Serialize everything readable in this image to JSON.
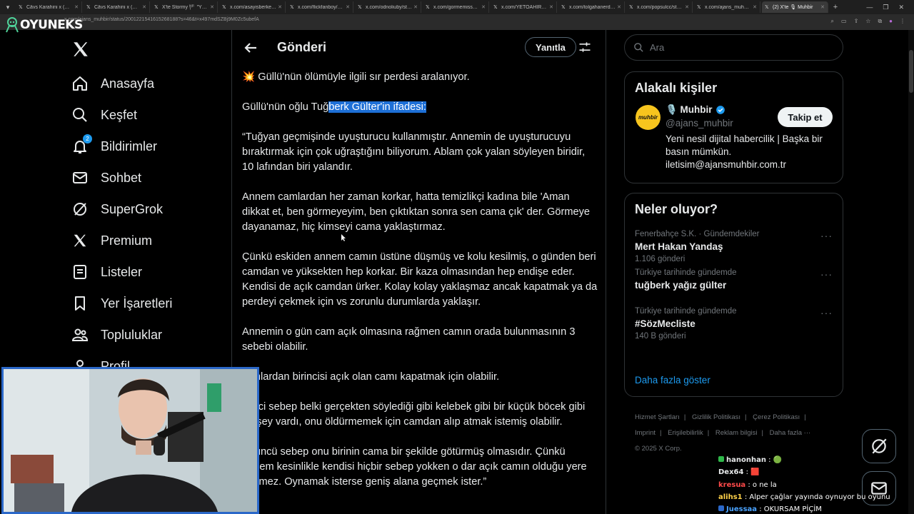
{
  "browser": {
    "tabs": [
      {
        "label": "Câvs Karahini x (@cs"
      },
      {
        "label": "Câvs Karahini x (@cs"
      },
      {
        "label": "X'te Stormy 🏴 \"Yüzsü"
      },
      {
        "label": "x.com/asayisberkemal"
      },
      {
        "label": "x.com/flickfanboy/stat"
      },
      {
        "label": "x.com/odnoliuby/statu"
      },
      {
        "label": "x.com/gormemissay/s"
      },
      {
        "label": "x.com/YETOAHIR/statu"
      },
      {
        "label": "x.com/tolgahanerdog"
      },
      {
        "label": "x.com/popsulcc/statu"
      },
      {
        "label": "x.com/ajans_muhbir/s"
      },
      {
        "label": "(2) X'te 🎙 Muhbir"
      }
    ],
    "url": "x.com/ajans_muhbir/status/2001221541615268188?s=46&t=x497mdSZBj9M0Zc5ubefA"
  },
  "overlay": {
    "logo_text": "OYUNEKS"
  },
  "nav": {
    "items": [
      {
        "label": "Anasayfa",
        "icon": "home-icon"
      },
      {
        "label": "Keşfet",
        "icon": "search-icon"
      },
      {
        "label": "Bildirimler",
        "icon": "bell-icon",
        "badge": "2"
      },
      {
        "label": "Sohbet",
        "icon": "mail-icon"
      },
      {
        "label": "SuperGrok",
        "icon": "grok-icon"
      },
      {
        "label": "Premium",
        "icon": "x-icon"
      },
      {
        "label": "Listeler",
        "icon": "list-icon"
      },
      {
        "label": "Yer İşaretleri",
        "icon": "bookmark-icon"
      },
      {
        "label": "Topluluklar",
        "icon": "community-icon"
      },
      {
        "label": "Profil",
        "icon": "profile-icon"
      }
    ]
  },
  "post": {
    "header_title": "Gönderi",
    "reply_label": "Yanıtla",
    "line1": "💥 Güllü'nün ölümüyle ilgili sır perdesi aralanıyor.",
    "line2_plain": "Güllü'nün oğlu Tuğ",
    "line2_highlight": "berk Gülter'in ifadesi:",
    "paragraphs": [
      "“Tuğyan geçmişinde uyuşturucu kullanmıştır. Annemin de uyuşturucuyu bıraktırmak için çok uğraştığını biliyorum. Ablam çok yalan söyleyen biridir, 10 lafından biri yalandır.",
      "Annem camlardan her zaman korkar, hatta temizlikçi kadına bile 'Aman dikkat et, ben görmeyeyim, ben çıktıktan sonra sen cama çık' der. Görmeye dayanamaz, hiç kimseyi cama yaklaştırmaz.",
      "Çünkü eskiden annem camın üstüne düşmüş ve kolu kesilmiş, o günden beri camdan ve yüksekten hep korkar. Bir kaza olmasından hep endişe eder. Kendisi de açık camdan ürker. Kolay kolay yaklaşmaz ancak kapatmak ya da perdeyi çekmek için vs zorunlu durumlarda yaklaşır.",
      "Annemin o gün cam açık olmasına rağmen camın orada bulunmasının 3 sebebi olabilir.",
      "Bunlardan birincisi açık olan camı kapatmak için olabilir.",
      "İkinci sebep belki gerçekten söylediği gibi kelebek gibi bir küçük böcek gibi bir şey vardı, onu öldürmemek için camdan alıp atmak istemiş olabilir.",
      "Üçüncü sebep onu birinin cama bir şekilde götürmüş olmasıdır. Çünkü annem kesinlikle kendisi hiçbir sebep yokken o dar açık camın olduğu yere geçmez. Oynamak isterse geniş alana geçmek ister.”"
    ]
  },
  "right": {
    "search_placeholder": "Ara",
    "related": {
      "title": "Alakalı kişiler",
      "name": "🎙️ Muhbir",
      "handle": "@ajans_muhbir",
      "bio": "Yeni nesil dijital habercilik | Başka bir basın mümkün. iletisim@ajansmuhbir.com.tr",
      "follow_label": "Takip et",
      "avatar_text": "muhbir"
    },
    "trends": {
      "title": "Neler oluyor?",
      "items": [
        {
          "context": "Fenerbahçe S.K. · Gündemdekiler",
          "name": "Mert Hakan Yandaş",
          "count": "1.106 gönderi"
        },
        {
          "context": "Türkiye tarihinde gündemde",
          "name": "tuğberk yağız gülter",
          "count": ""
        },
        {
          "context": "Türkiye tarihinde gündemde",
          "name": "#SözMecliste",
          "count": "140 B gönderi"
        }
      ],
      "show_more": "Daha fazla göster"
    },
    "footer": [
      "Hizmet Şartları",
      "|",
      "Gizlilik Politikası",
      "|",
      "Çerez Politikası",
      "|",
      "Imprint",
      "|",
      "Erişilebilirlik",
      "|",
      "Reklam bilgisi",
      "|",
      "Daha fazla ···",
      "© 2025 X Corp."
    ]
  },
  "chat": [
    {
      "user": "hanonhan",
      "msg": "🟢",
      "color": "#e7e9ea",
      "badge": "#2fb84a"
    },
    {
      "user": "Dex64",
      "msg": "🟥",
      "color": "#e7e9ea",
      "badge": ""
    },
    {
      "user": "kresua",
      "msg": "o ne la",
      "color": "#ff4a4a",
      "badge": ""
    },
    {
      "user": "alihs1",
      "msg": "Alper çağlar yayında oynuyor bu oyunu",
      "color": "#ffd24a",
      "badge": ""
    },
    {
      "user": "Juessaa",
      "msg": "OKURSAM PİÇİM",
      "color": "#4aa3ff",
      "badge": "#2b68c9"
    }
  ],
  "colors": {
    "accent": "#1d9bf0",
    "highlight": "#1d6fd6",
    "webcam_border": "#2b68c9"
  }
}
